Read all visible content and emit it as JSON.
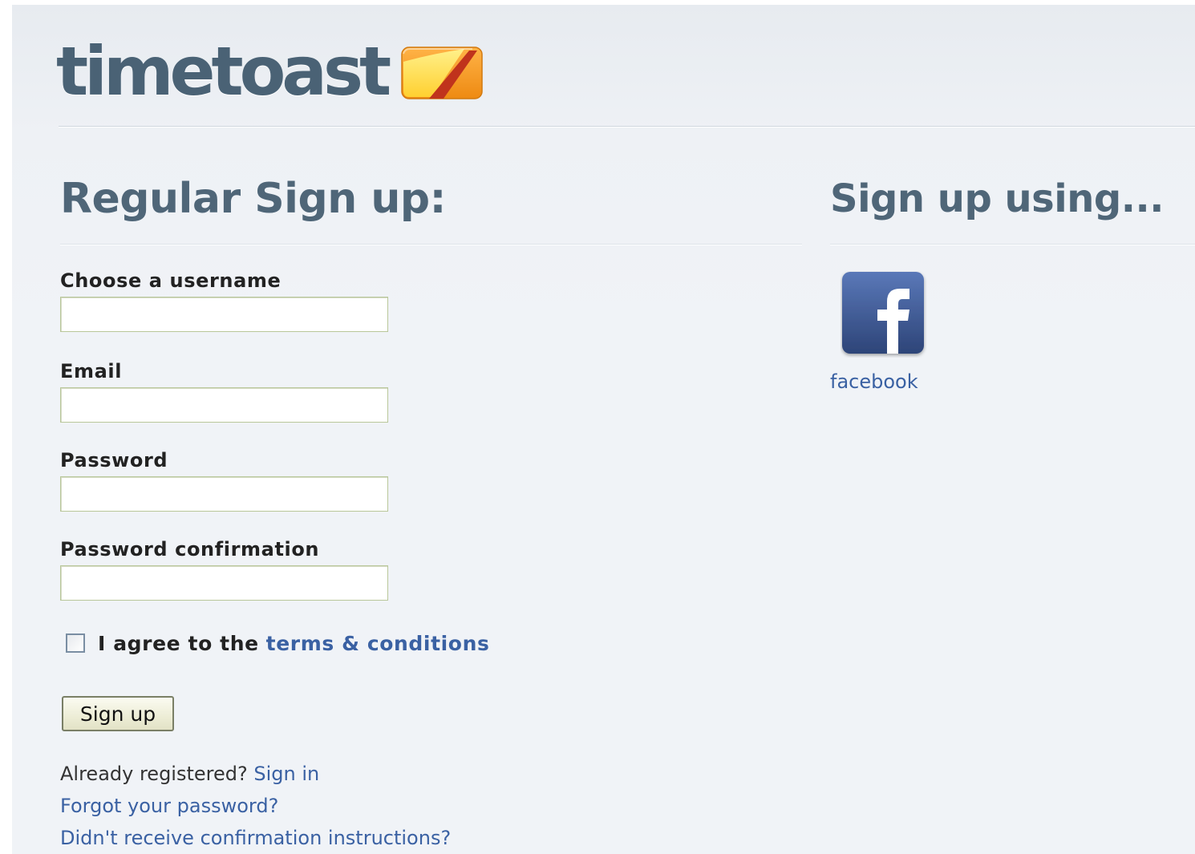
{
  "brand": {
    "name": "timetoast",
    "colors": {
      "logo_text": "#4a6275",
      "logo_mark_orange": "#f39a22",
      "logo_mark_yellow": "#ffd84a",
      "logo_mark_red": "#c0331c"
    }
  },
  "regular_signup": {
    "title": "Regular Sign up:",
    "fields": [
      {
        "label": "Choose a username",
        "value": "",
        "placeholder": ""
      },
      {
        "label": "Email",
        "value": "",
        "placeholder": ""
      },
      {
        "label": "Password",
        "value": "",
        "placeholder": ""
      },
      {
        "label": "Password confirmation",
        "value": "",
        "placeholder": ""
      }
    ],
    "agree": {
      "checked": false,
      "text": "I agree to the",
      "link_text": "terms & conditions"
    },
    "submit_label": "Sign up",
    "links": {
      "already_registered_text": "Already registered?",
      "sign_in": "Sign in",
      "forgot_password": "Forgot your password?",
      "confirmation": "Didn't receive confirmation instructions?"
    }
  },
  "social_signup": {
    "title": "Sign up using...",
    "providers": [
      {
        "name": "facebook",
        "icon": "facebook-icon",
        "color": "#3b5998"
      }
    ]
  },
  "colors": {
    "heading": "#4f6678",
    "link": "#3a61a3",
    "label": "#222222",
    "input_border": "#b9c79a"
  }
}
